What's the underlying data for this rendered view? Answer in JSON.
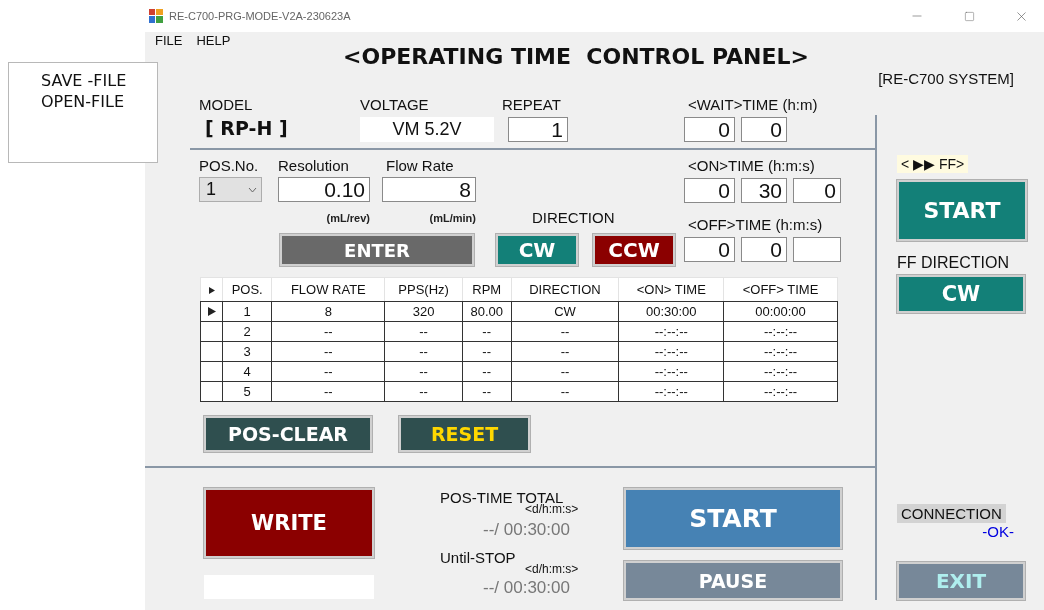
{
  "file_menu": {
    "items": [
      "SAVE -FILE",
      "OPEN-FILE"
    ]
  },
  "window": {
    "title": "RE-C700-PRG-MODE-V2A-230623A"
  },
  "menu_bar": [
    "FILE",
    "HELP"
  ],
  "title": "<OPERATING TIME  CONTROL PANEL>",
  "system_label": "[RE-C700 SYSTEM]",
  "model": {
    "label": "MODEL",
    "value": "[ RP-H ]"
  },
  "voltage": {
    "label": "VOLTAGE",
    "value": "VM 5.2V"
  },
  "repeat": {
    "label": "REPEAT",
    "value": "1"
  },
  "wait_time": {
    "label": "<WAIT>TIME (h:m)",
    "fields": [
      {
        "kind": "value",
        "value": "0"
      },
      {
        "kind": "value",
        "value": "0"
      }
    ]
  },
  "pos_no": {
    "label": "POS.No.",
    "value": "1"
  },
  "resolution": {
    "label": "Resolution",
    "value": "0.10",
    "unit": "(mL/rev)"
  },
  "flow_rate": {
    "label": "Flow Rate",
    "value": "8",
    "unit": "(mL/min)"
  },
  "on_time": {
    "label": "<ON>TIME (h:m:s)",
    "fields": [
      {
        "kind": "value",
        "value": "0"
      },
      {
        "kind": "value",
        "value": "30"
      },
      {
        "kind": "value",
        "value": "0"
      }
    ]
  },
  "off_time": {
    "label": "<OFF>TIME (h:m:s)",
    "fields": [
      {
        "kind": "value",
        "value": "0"
      },
      {
        "kind": "value",
        "value": "0"
      },
      {
        "kind": "blank"
      }
    ]
  },
  "enter_button": "ENTER",
  "direction": {
    "label": "DIRECTION",
    "options": [
      {
        "label": "CW",
        "color": "#138078"
      },
      {
        "label": "CCW",
        "color": "#8b0000"
      }
    ]
  },
  "table": {
    "columns": [
      "POS.",
      "FLOW RATE",
      "PPS(Hz)",
      "RPM",
      "DIRECTION",
      "<ON> TIME",
      "<OFF> TIME"
    ],
    "rows": [
      {
        "selected": true,
        "cells": [
          "1",
          "8",
          "320",
          "80.00",
          "CW",
          "00:30:00",
          "00:00:00"
        ]
      },
      {
        "selected": false,
        "cells": [
          "2",
          "--",
          "--",
          "--",
          "--",
          "--:--:--",
          "--:--:--"
        ]
      },
      {
        "selected": false,
        "cells": [
          "3",
          "--",
          "--",
          "--",
          "--",
          "--:--:--",
          "--:--:--"
        ]
      },
      {
        "selected": false,
        "cells": [
          "4",
          "--",
          "--",
          "--",
          "--",
          "--:--:--",
          "--:--:--"
        ]
      },
      {
        "selected": false,
        "cells": [
          "5",
          "--",
          "--",
          "--",
          "--",
          "--:--:--",
          "--:--:--"
        ]
      }
    ]
  },
  "pos_clear_button": "POS-CLEAR",
  "reset_button": "RESET",
  "write_button": "WRITE",
  "pos_time_total": {
    "label": "POS-TIME TOTAL",
    "unit": "<d/h:m:s>",
    "value": "--/ 00:30:00"
  },
  "until_stop": {
    "label": "Until-STOP",
    "unit": "<d/h:m:s>",
    "value": "--/ 00:30:00"
  },
  "start_button": "START",
  "pause_button": "PAUSE",
  "ff": {
    "label": "< ▶▶ FF>",
    "start_button": "START",
    "direction_label": "FF DIRECTION",
    "direction_button": "CW"
  },
  "connection": {
    "label": "CONNECTION",
    "status": "-OK-"
  },
  "exit_button": "EXIT"
}
